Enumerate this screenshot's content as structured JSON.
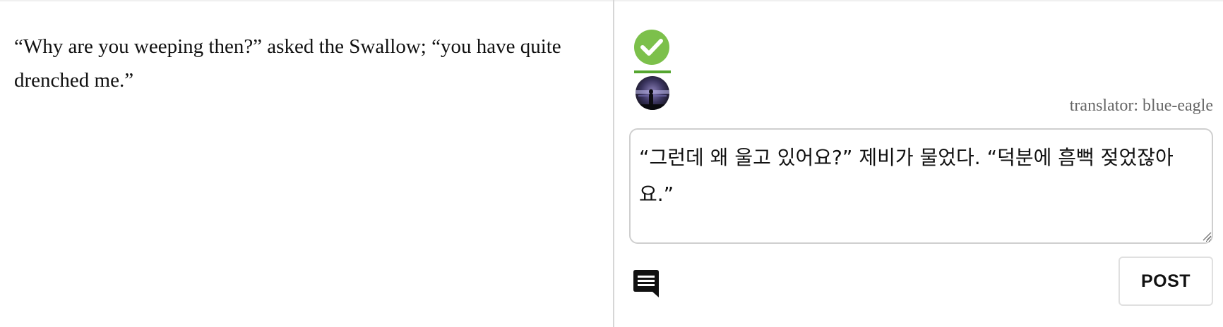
{
  "source": {
    "text": "“Why are you weeping then?” asked the Swallow; “you have quite drenched me.”"
  },
  "translation": {
    "translator_label": "translator: blue-eagle",
    "text": "“그런데 왜 울고 있어요?” 제비가 물었다. “덕분에 흠뻑 젖었잖아요.”",
    "status": "approved"
  },
  "actions": {
    "post_label": "POST"
  },
  "icons": {
    "approved": "check-circle-icon",
    "comment": "comment-icon",
    "resize": "resize-grip-icon"
  },
  "colors": {
    "approved_green": "#7cc04b",
    "approved_underline": "#55a630",
    "border": "#cfcfcf",
    "text": "#111111",
    "muted_text": "#666666"
  }
}
